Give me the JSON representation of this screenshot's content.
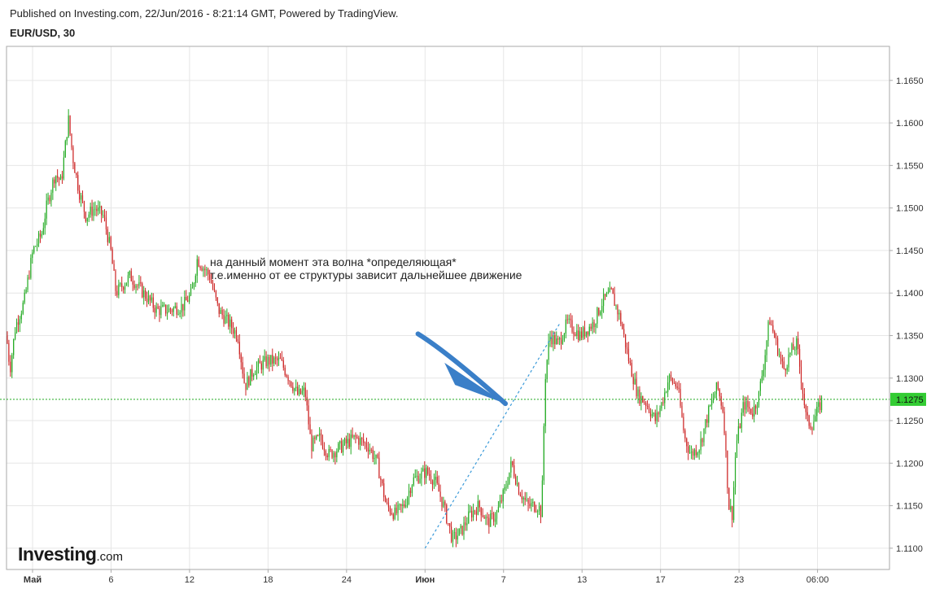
{
  "header": {
    "published": "Published on Investing.com, 22/Jun/2016 - 8:21:14 GMT, Powered by TradingView.",
    "symbol": "EUR/USD, 30"
  },
  "brand": {
    "name": "Investing",
    "suffix": ".com"
  },
  "annotation": {
    "line1": "на данный момент эта волна *определяющая*",
    "line2": "т.е.именно от ее структуры зависит дальнейшее движение"
  },
  "colors": {
    "up": "#22aa22",
    "down": "#cc2222",
    "grid": "#e6e6e6",
    "axis": "#aaaaaa",
    "current_price_bg": "#33cc33",
    "current_price_line": "#22aa22",
    "arrow": "#3a7fc8",
    "trendline": "#3a9ad9"
  },
  "chart_data": {
    "type": "candlestick",
    "title": "EUR/USD, 30",
    "ylim": [
      1.1075,
      1.169
    ],
    "yticks": [
      "1.1100",
      "1.1150",
      "1.1200",
      "1.1250",
      "1.1300",
      "1.1350",
      "1.1400",
      "1.1450",
      "1.1500",
      "1.1550",
      "1.1600",
      "1.1650"
    ],
    "xticks": [
      "Май",
      "6",
      "12",
      "18",
      "24",
      "Июн",
      "7",
      "13",
      "17",
      "23",
      "06:00"
    ],
    "current_price": "1.1275",
    "grid": true,
    "path_keypoints": [
      [
        0.0,
        1.135
      ],
      [
        0.004,
        1.131
      ],
      [
        0.01,
        1.136
      ],
      [
        0.02,
        1.139
      ],
      [
        0.03,
        1.145
      ],
      [
        0.04,
        1.147
      ],
      [
        0.045,
        1.15
      ],
      [
        0.055,
        1.154
      ],
      [
        0.062,
        1.153
      ],
      [
        0.07,
        1.1605
      ],
      [
        0.075,
        1.156
      ],
      [
        0.082,
        1.152
      ],
      [
        0.09,
        1.149
      ],
      [
        0.1,
        1.15
      ],
      [
        0.11,
        1.149
      ],
      [
        0.118,
        1.145
      ],
      [
        0.124,
        1.14
      ],
      [
        0.14,
        1.142
      ],
      [
        0.155,
        1.14
      ],
      [
        0.17,
        1.138
      ],
      [
        0.185,
        1.138
      ],
      [
        0.2,
        1.1385
      ],
      [
        0.21,
        1.14
      ],
      [
        0.216,
        1.144
      ],
      [
        0.23,
        1.142
      ],
      [
        0.24,
        1.138
      ],
      [
        0.255,
        1.136
      ],
      [
        0.262,
        1.135
      ],
      [
        0.27,
        1.129
      ],
      [
        0.28,
        1.131
      ],
      [
        0.295,
        1.132
      ],
      [
        0.31,
        1.132
      ],
      [
        0.32,
        1.13
      ],
      [
        0.33,
        1.128
      ],
      [
        0.338,
        1.1285
      ],
      [
        0.345,
        1.122
      ],
      [
        0.355,
        1.123
      ],
      [
        0.365,
        1.121
      ],
      [
        0.38,
        1.122
      ],
      [
        0.395,
        1.123
      ],
      [
        0.41,
        1.122
      ],
      [
        0.42,
        1.12
      ],
      [
        0.43,
        1.115
      ],
      [
        0.44,
        1.114
      ],
      [
        0.45,
        1.115
      ],
      [
        0.46,
        1.118
      ],
      [
        0.475,
        1.119
      ],
      [
        0.485,
        1.118
      ],
      [
        0.495,
        1.115
      ],
      [
        0.505,
        1.111
      ],
      [
        0.515,
        1.112
      ],
      [
        0.525,
        1.114
      ],
      [
        0.535,
        1.115
      ],
      [
        0.545,
        1.113
      ],
      [
        0.555,
        1.114
      ],
      [
        0.565,
        1.117
      ],
      [
        0.572,
        1.12
      ],
      [
        0.58,
        1.117
      ],
      [
        0.59,
        1.115
      ],
      [
        0.602,
        1.115
      ],
      [
        0.606,
        1.114
      ],
      [
        0.61,
        1.13
      ],
      [
        0.615,
        1.135
      ],
      [
        0.625,
        1.134
      ],
      [
        0.635,
        1.1365
      ],
      [
        0.65,
        1.135
      ],
      [
        0.665,
        1.1365
      ],
      [
        0.675,
        1.139
      ],
      [
        0.685,
        1.14
      ],
      [
        0.695,
        1.137
      ],
      [
        0.705,
        1.132
      ],
      [
        0.715,
        1.128
      ],
      [
        0.725,
        1.127
      ],
      [
        0.735,
        1.125
      ],
      [
        0.742,
        1.127
      ],
      [
        0.75,
        1.13
      ],
      [
        0.76,
        1.129
      ],
      [
        0.768,
        1.123
      ],
      [
        0.775,
        1.121
      ],
      [
        0.785,
        1.122
      ],
      [
        0.795,
        1.126
      ],
      [
        0.805,
        1.129
      ],
      [
        0.812,
        1.126
      ],
      [
        0.818,
        1.115
      ],
      [
        0.822,
        1.114
      ],
      [
        0.826,
        1.122
      ],
      [
        0.835,
        1.127
      ],
      [
        0.845,
        1.126
      ],
      [
        0.852,
        1.128
      ],
      [
        0.858,
        1.132
      ],
      [
        0.864,
        1.137
      ],
      [
        0.872,
        1.134
      ],
      [
        0.88,
        1.131
      ],
      [
        0.888,
        1.133
      ],
      [
        0.895,
        1.134
      ],
      [
        0.9,
        1.13
      ],
      [
        0.906,
        1.125
      ],
      [
        0.912,
        1.1245
      ],
      [
        0.918,
        1.126
      ],
      [
        0.924,
        1.1275
      ]
    ],
    "data_span": 0.924
  }
}
